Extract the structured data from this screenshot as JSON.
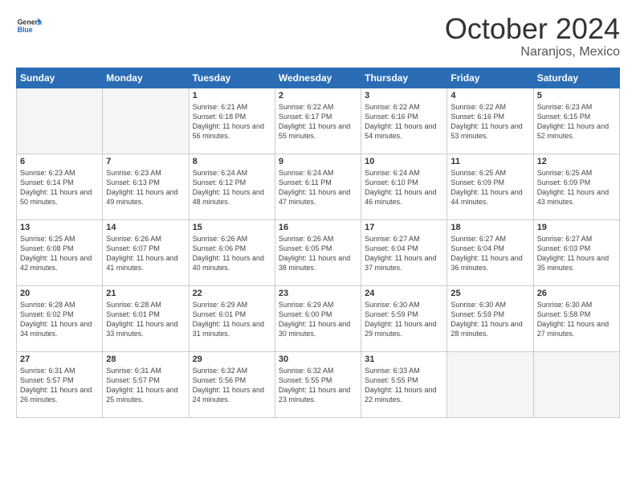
{
  "header": {
    "logo_general": "General",
    "logo_blue": "Blue",
    "month": "October 2024",
    "location": "Naranjos, Mexico"
  },
  "days_of_week": [
    "Sunday",
    "Monday",
    "Tuesday",
    "Wednesday",
    "Thursday",
    "Friday",
    "Saturday"
  ],
  "weeks": [
    [
      {
        "day": "",
        "info": ""
      },
      {
        "day": "",
        "info": ""
      },
      {
        "day": "1",
        "info": "Sunrise: 6:21 AM\nSunset: 6:18 PM\nDaylight: 11 hours and 56 minutes."
      },
      {
        "day": "2",
        "info": "Sunrise: 6:22 AM\nSunset: 6:17 PM\nDaylight: 11 hours and 55 minutes."
      },
      {
        "day": "3",
        "info": "Sunrise: 6:22 AM\nSunset: 6:16 PM\nDaylight: 11 hours and 54 minutes."
      },
      {
        "day": "4",
        "info": "Sunrise: 6:22 AM\nSunset: 6:16 PM\nDaylight: 11 hours and 53 minutes."
      },
      {
        "day": "5",
        "info": "Sunrise: 6:23 AM\nSunset: 6:15 PM\nDaylight: 11 hours and 52 minutes."
      }
    ],
    [
      {
        "day": "6",
        "info": "Sunrise: 6:23 AM\nSunset: 6:14 PM\nDaylight: 11 hours and 50 minutes."
      },
      {
        "day": "7",
        "info": "Sunrise: 6:23 AM\nSunset: 6:13 PM\nDaylight: 11 hours and 49 minutes."
      },
      {
        "day": "8",
        "info": "Sunrise: 6:24 AM\nSunset: 6:12 PM\nDaylight: 11 hours and 48 minutes."
      },
      {
        "day": "9",
        "info": "Sunrise: 6:24 AM\nSunset: 6:11 PM\nDaylight: 11 hours and 47 minutes."
      },
      {
        "day": "10",
        "info": "Sunrise: 6:24 AM\nSunset: 6:10 PM\nDaylight: 11 hours and 46 minutes."
      },
      {
        "day": "11",
        "info": "Sunrise: 6:25 AM\nSunset: 6:09 PM\nDaylight: 11 hours and 44 minutes."
      },
      {
        "day": "12",
        "info": "Sunrise: 6:25 AM\nSunset: 6:09 PM\nDaylight: 11 hours and 43 minutes."
      }
    ],
    [
      {
        "day": "13",
        "info": "Sunrise: 6:25 AM\nSunset: 6:08 PM\nDaylight: 11 hours and 42 minutes."
      },
      {
        "day": "14",
        "info": "Sunrise: 6:26 AM\nSunset: 6:07 PM\nDaylight: 11 hours and 41 minutes."
      },
      {
        "day": "15",
        "info": "Sunrise: 6:26 AM\nSunset: 6:06 PM\nDaylight: 11 hours and 40 minutes."
      },
      {
        "day": "16",
        "info": "Sunrise: 6:26 AM\nSunset: 6:05 PM\nDaylight: 11 hours and 38 minutes."
      },
      {
        "day": "17",
        "info": "Sunrise: 6:27 AM\nSunset: 6:04 PM\nDaylight: 11 hours and 37 minutes."
      },
      {
        "day": "18",
        "info": "Sunrise: 6:27 AM\nSunset: 6:04 PM\nDaylight: 11 hours and 36 minutes."
      },
      {
        "day": "19",
        "info": "Sunrise: 6:27 AM\nSunset: 6:03 PM\nDaylight: 11 hours and 35 minutes."
      }
    ],
    [
      {
        "day": "20",
        "info": "Sunrise: 6:28 AM\nSunset: 6:02 PM\nDaylight: 11 hours and 34 minutes."
      },
      {
        "day": "21",
        "info": "Sunrise: 6:28 AM\nSunset: 6:01 PM\nDaylight: 11 hours and 33 minutes."
      },
      {
        "day": "22",
        "info": "Sunrise: 6:29 AM\nSunset: 6:01 PM\nDaylight: 11 hours and 31 minutes."
      },
      {
        "day": "23",
        "info": "Sunrise: 6:29 AM\nSunset: 6:00 PM\nDaylight: 11 hours and 30 minutes."
      },
      {
        "day": "24",
        "info": "Sunrise: 6:30 AM\nSunset: 5:59 PM\nDaylight: 11 hours and 29 minutes."
      },
      {
        "day": "25",
        "info": "Sunrise: 6:30 AM\nSunset: 5:59 PM\nDaylight: 11 hours and 28 minutes."
      },
      {
        "day": "26",
        "info": "Sunrise: 6:30 AM\nSunset: 5:58 PM\nDaylight: 11 hours and 27 minutes."
      }
    ],
    [
      {
        "day": "27",
        "info": "Sunrise: 6:31 AM\nSunset: 5:57 PM\nDaylight: 11 hours and 26 minutes."
      },
      {
        "day": "28",
        "info": "Sunrise: 6:31 AM\nSunset: 5:57 PM\nDaylight: 11 hours and 25 minutes."
      },
      {
        "day": "29",
        "info": "Sunrise: 6:32 AM\nSunset: 5:56 PM\nDaylight: 11 hours and 24 minutes."
      },
      {
        "day": "30",
        "info": "Sunrise: 6:32 AM\nSunset: 5:55 PM\nDaylight: 11 hours and 23 minutes."
      },
      {
        "day": "31",
        "info": "Sunrise: 6:33 AM\nSunset: 5:55 PM\nDaylight: 11 hours and 22 minutes."
      },
      {
        "day": "",
        "info": ""
      },
      {
        "day": "",
        "info": ""
      }
    ]
  ]
}
